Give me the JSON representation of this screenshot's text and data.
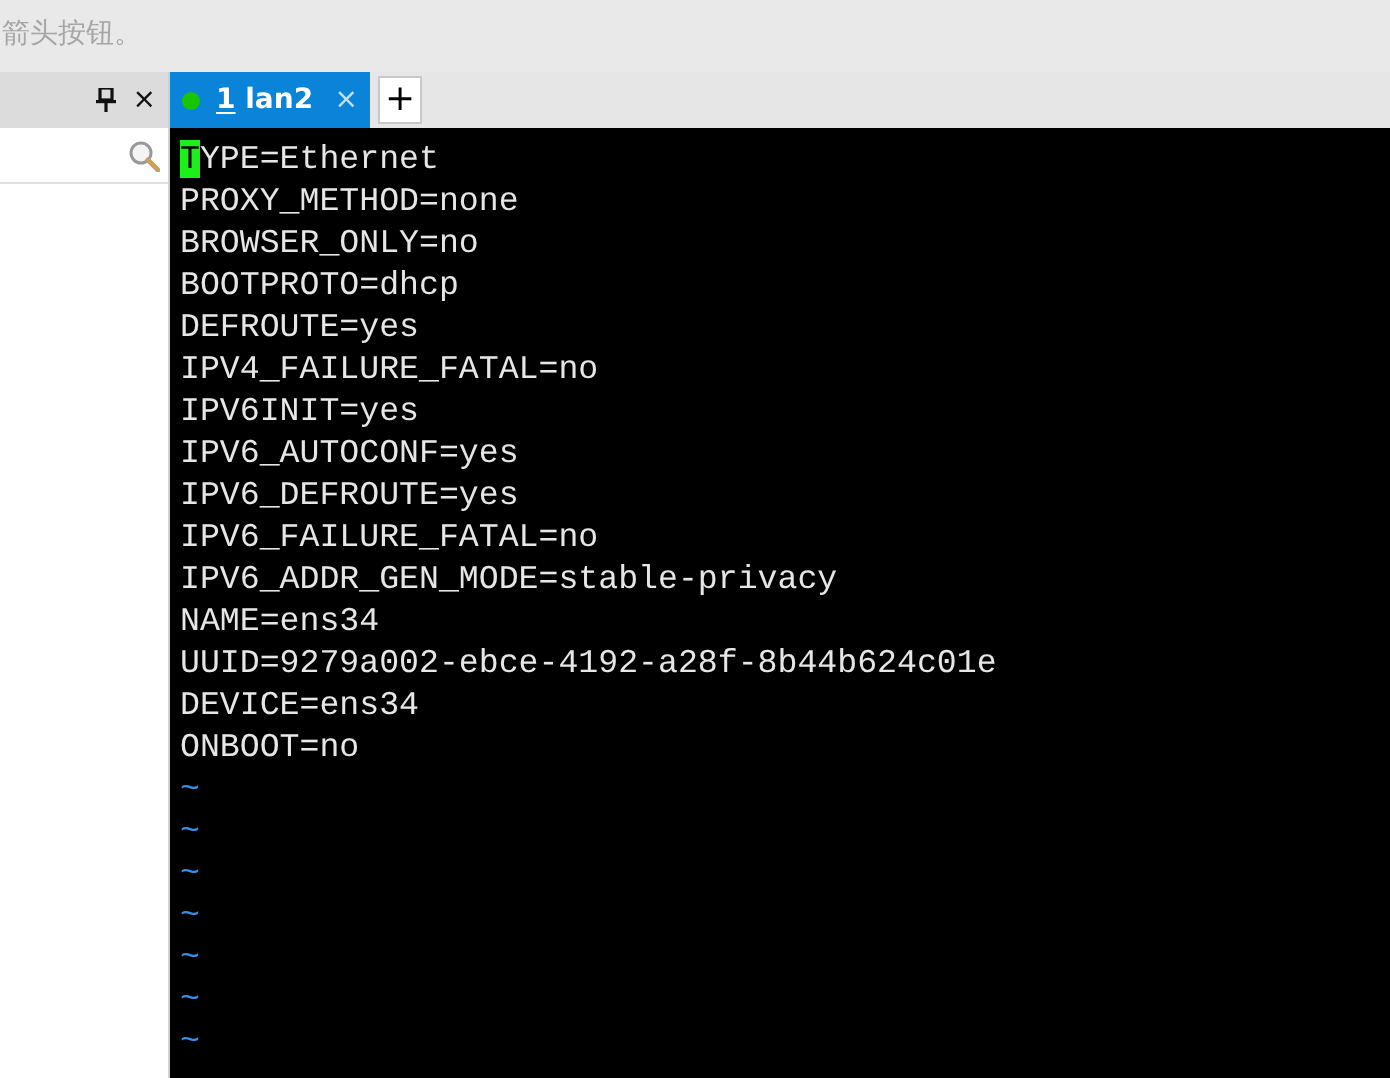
{
  "hint_text": "箭头按钮。",
  "side_panel": {
    "close": "×"
  },
  "tabs": [
    {
      "number": "1",
      "label": "lan2",
      "selected": true,
      "color": "#19c400",
      "close": "×"
    }
  ],
  "new_tab": "+",
  "terminal": {
    "lines": [
      {
        "kind": "text",
        "text": "TYPE=Ethernet",
        "cursor": true
      },
      {
        "kind": "text",
        "text": "PROXY_METHOD=none",
        "cursor": false
      },
      {
        "kind": "text",
        "text": "BROWSER_ONLY=no",
        "cursor": false
      },
      {
        "kind": "text",
        "text": "BOOTPROTO=dhcp",
        "cursor": false
      },
      {
        "kind": "text",
        "text": "DEFROUTE=yes",
        "cursor": false
      },
      {
        "kind": "text",
        "text": "IPV4_FAILURE_FATAL=no",
        "cursor": false
      },
      {
        "kind": "text",
        "text": "IPV6INIT=yes",
        "cursor": false
      },
      {
        "kind": "text",
        "text": "IPV6_AUTOCONF=yes",
        "cursor": false
      },
      {
        "kind": "text",
        "text": "IPV6_DEFROUTE=yes",
        "cursor": false
      },
      {
        "kind": "text",
        "text": "IPV6_FAILURE_FATAL=no",
        "cursor": false
      },
      {
        "kind": "text",
        "text": "IPV6_ADDR_GEN_MODE=stable-privacy",
        "cursor": false
      },
      {
        "kind": "text",
        "text": "NAME=ens34",
        "cursor": false
      },
      {
        "kind": "text",
        "text": "UUID=9279a002-ebce-4192-a28f-8b44b624c01e",
        "cursor": false
      },
      {
        "kind": "text",
        "text": "DEVICE=ens34",
        "cursor": false
      },
      {
        "kind": "text",
        "text": "ONBOOT=no",
        "cursor": false
      },
      {
        "kind": "tilde",
        "text": "~"
      },
      {
        "kind": "tilde",
        "text": "~"
      },
      {
        "kind": "tilde",
        "text": "~"
      },
      {
        "kind": "tilde",
        "text": "~"
      },
      {
        "kind": "tilde",
        "text": "~"
      },
      {
        "kind": "tilde",
        "text": "~"
      },
      {
        "kind": "tilde",
        "text": "~"
      }
    ]
  }
}
